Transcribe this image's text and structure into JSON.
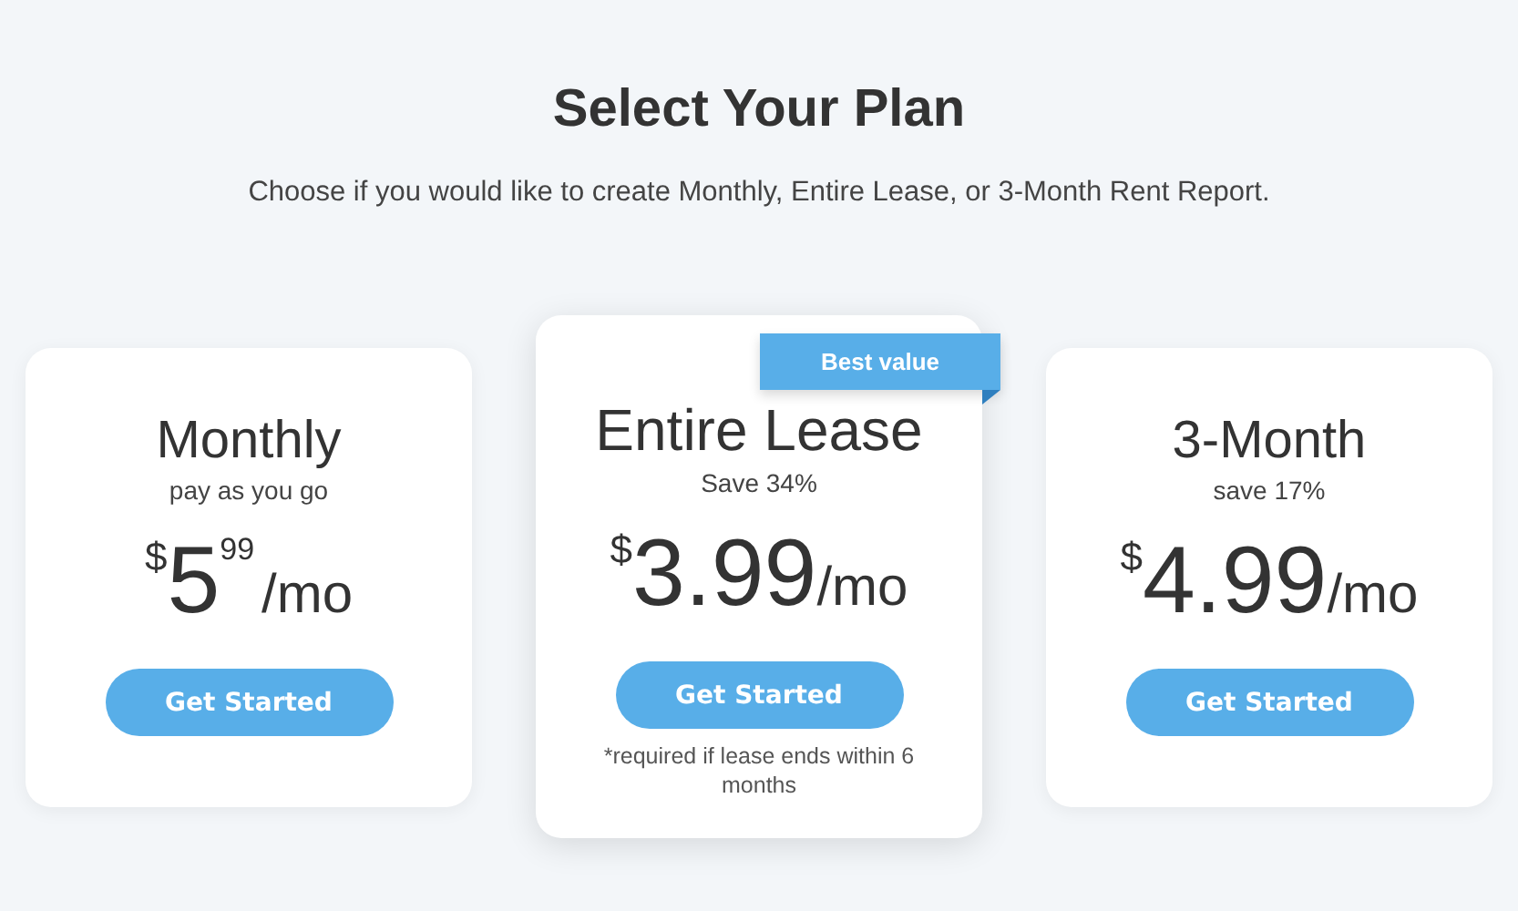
{
  "title": "Select Your Plan",
  "subtitle": "Choose if you would like to create Monthly, Entire Lease, or 3-Month Rent Report.",
  "plans": [
    {
      "name": "Monthly",
      "tagline": "pay as you go",
      "price": {
        "currency": "$",
        "amount": "5",
        "cents": "99",
        "unit": "/mo"
      },
      "button": "Get Started",
      "featured": false
    },
    {
      "name": "Entire Lease",
      "tagline": "Save 34%",
      "price": {
        "currency": "$",
        "amount": "3.99",
        "unit": "/mo"
      },
      "button": "Get Started",
      "featured": true,
      "badge": "Best value",
      "note": "*required if lease ends within 6 months"
    },
    {
      "name": "3-Month",
      "tagline": "save 17%",
      "price": {
        "currency": "$",
        "amount": "4.99",
        "unit": "/mo"
      },
      "button": "Get Started",
      "featured": false
    }
  ]
}
